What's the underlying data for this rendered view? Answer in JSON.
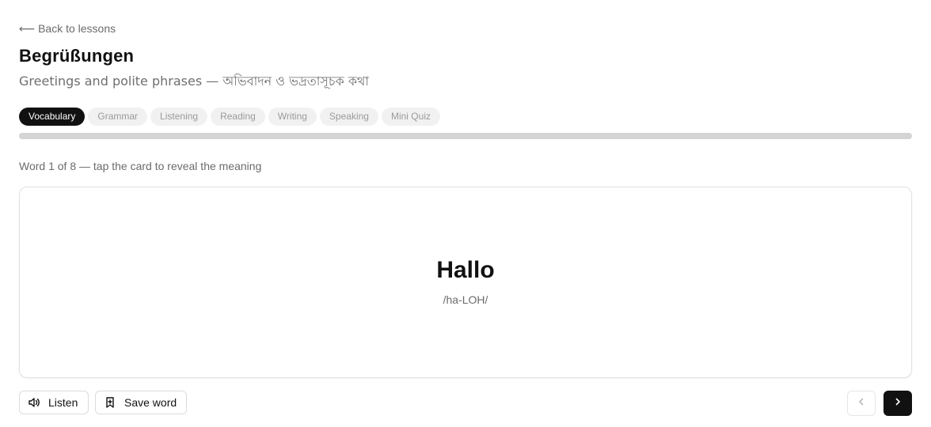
{
  "back_link": {
    "arrow": "⟵",
    "label": "Back to lessons"
  },
  "lesson": {
    "title": "Begrüßungen",
    "subtitle": "Greetings and polite phrases — অভিবাদন ও ভদ্রতাসূচক কথা"
  },
  "tabs": [
    {
      "label": "Vocabulary",
      "active": true
    },
    {
      "label": "Grammar",
      "active": false
    },
    {
      "label": "Listening",
      "active": false
    },
    {
      "label": "Reading",
      "active": false
    },
    {
      "label": "Writing",
      "active": false
    },
    {
      "label": "Speaking",
      "active": false
    },
    {
      "label": "Mini Quiz",
      "active": false
    }
  ],
  "progress": {
    "fraction": 0.0
  },
  "counter": "Word 1 of 8 — tap the card to reveal the meaning",
  "card": {
    "word": "Hallo",
    "pronunciation": "/ha-LOH/"
  },
  "actions": {
    "listen_label": "Listen",
    "listen_icon": "speaker-icon",
    "save_label": "Save word",
    "save_icon": "bookmark-icon",
    "prev_icon": "chevron-left-icon",
    "next_icon": "chevron-right-icon"
  },
  "colors": {
    "accent": "#111111",
    "muted": "#6b6b6b",
    "track": "#d4d4d4"
  }
}
